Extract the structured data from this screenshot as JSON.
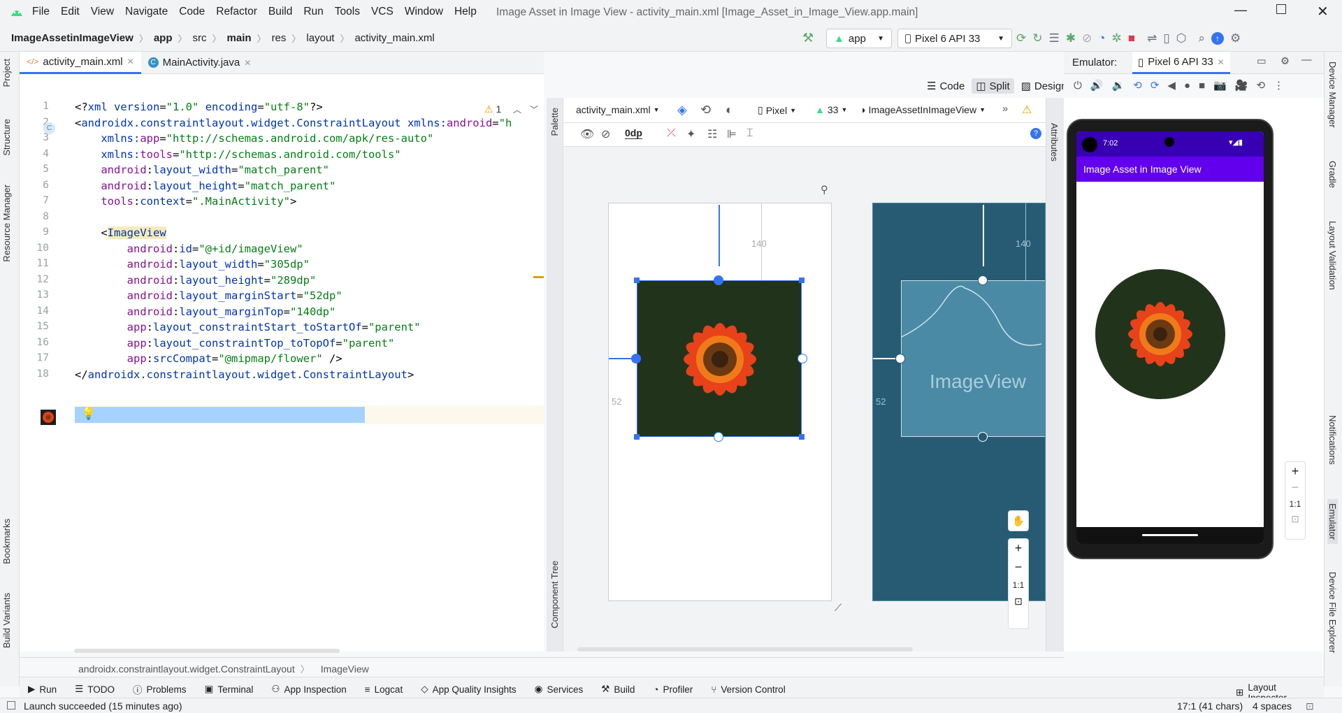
{
  "titlebar": {
    "menu": [
      "File",
      "Edit",
      "View",
      "Navigate",
      "Code",
      "Refactor",
      "Build",
      "Run",
      "Tools",
      "VCS",
      "Window",
      "Help"
    ],
    "title": "Image Asset in Image View - activity_main.xml [Image_Asset_in_Image_View.app.main]"
  },
  "navbar": {
    "crumbs": [
      "ImageAssetinImageView",
      "app",
      "src",
      "main",
      "res",
      "layout",
      "activity_main.xml"
    ],
    "run_config": "app",
    "device": "Pixel 6 API 33"
  },
  "left_tabs": [
    "Project",
    "Structure",
    "Resource Manager",
    "Bookmarks",
    "Build Variants"
  ],
  "right_tabs": [
    "Device Manager",
    "Gradle",
    "Layout Validation",
    "Notifications",
    "Emulator",
    "Device File Explorer"
  ],
  "file_tabs": [
    "activity_main.xml",
    "MainActivity.java"
  ],
  "view_modes": [
    "Code",
    "Split",
    "Design"
  ],
  "editor": {
    "warnings": "1",
    "lines": [
      {
        "n": "1",
        "html": "<span>&lt;?</span><span class='k'>xml version</span>=<span class='s'>\"1.0\"</span> <span class='k'>encoding</span>=<span class='s'>\"utf-8\"</span>?&gt;"
      },
      {
        "n": "2",
        "html": "&lt;<span class='t'>androidx.constraintlayout.widget.ConstraintLayout</span> <span class='k'>xmlns:</span><span class='a'>android</span>=<span class='s'>\"h</span>"
      },
      {
        "n": "3",
        "html": "    <span class='k'>xmlns:</span><span class='a'>app</span>=<span class='s'>\"http://schemas.android.com/apk/res-auto\"</span>"
      },
      {
        "n": "4",
        "html": "    <span class='k'>xmlns:</span><span class='a'>tools</span>=<span class='s'>\"http://schemas.android.com/tools\"</span>"
      },
      {
        "n": "5",
        "html": "    <span class='a'>android</span>:<span class='k'>layout_width</span>=<span class='s'>\"match_parent\"</span>"
      },
      {
        "n": "6",
        "html": "    <span class='a'>android</span>:<span class='k'>layout_height</span>=<span class='s'>\"match_parent\"</span>"
      },
      {
        "n": "7",
        "html": "    <span class='a'>tools</span>:<span class='k'>context</span>=<span class='s'>\".MainActivity\"</span>&gt;"
      },
      {
        "n": "8",
        "html": ""
      },
      {
        "n": "9",
        "html": "    &lt;<span class='t' style='background:#f6ebbc'>ImageView</span>"
      },
      {
        "n": "10",
        "html": "        <span class='a'>android</span>:<span class='k'>id</span>=<span class='s'>\"@+id/imageView\"</span>"
      },
      {
        "n": "11",
        "html": "        <span class='a'>android</span>:<span class='k'>layout_width</span>=<span class='s'>\"305dp\"</span>"
      },
      {
        "n": "12",
        "html": "        <span class='a'>android</span>:<span class='k'>layout_height</span>=<span class='s'>\"289dp\"</span>"
      },
      {
        "n": "13",
        "html": "        <span class='a'>android</span>:<span class='k'>layout_marginStart</span>=<span class='s'>\"52dp\"</span>"
      },
      {
        "n": "14",
        "html": "        <span class='a'>android</span>:<span class='k'>layout_marginTop</span>=<span class='s'>\"140dp\"</span>"
      },
      {
        "n": "15",
        "html": "        <span class='a'>app</span>:<span class='k'>layout_constraintStart_toStartOf</span>=<span class='s'>\"parent\"</span>"
      },
      {
        "n": "16",
        "html": "        <span class='a'>app</span>:<span class='k'>layout_constraintTop_toTopOf</span>=<span class='s'>\"parent\"</span>"
      },
      {
        "n": "17",
        "html": "        <span class='a'>app</span>:<span class='k'>srcCompat</span>=<span class='s'>\"@mipmap/flower\"</span> /&gt;"
      },
      {
        "n": "18",
        "html": "&lt;/<span class='t'>androidx.constraintlayout.widget.ConstraintLayout</span>&gt;"
      }
    ]
  },
  "design_toolbar": {
    "file": "activity_main.xml",
    "device": "Pixel",
    "api": "33",
    "theme": "ImageAssetInImageView",
    "margin": "0dp"
  },
  "canvas": {
    "margin_top": "140",
    "margin_start": "52",
    "blueprint_label": "ImageView",
    "zoom_ratio": "1:1"
  },
  "side_tabs": {
    "palette": "Palette",
    "component_tree": "Component Tree",
    "attributes": "Attributes"
  },
  "emulator": {
    "label": "Emulator:",
    "device": "Pixel 6 API 33",
    "time": "7:02",
    "app_title": "Image Asset in Image View",
    "zoom_ratio": "1:1",
    "colors": {
      "appbar": "#6200ee",
      "statusbar": "#3700b3"
    }
  },
  "breadcrumb": [
    "androidx.constraintlayout.widget.ConstraintLayout",
    "ImageView"
  ],
  "bottom_tabs": [
    "Run",
    "TODO",
    "Problems",
    "Terminal",
    "App Inspection",
    "Logcat",
    "App Quality Insights",
    "Services",
    "Build",
    "Profiler",
    "Version Control"
  ],
  "layout_inspector": "Layout Inspector",
  "status": {
    "message": "Launch succeeded (15 minutes ago)",
    "position": "17:1 (41 chars)",
    "indent": "4 spaces"
  }
}
